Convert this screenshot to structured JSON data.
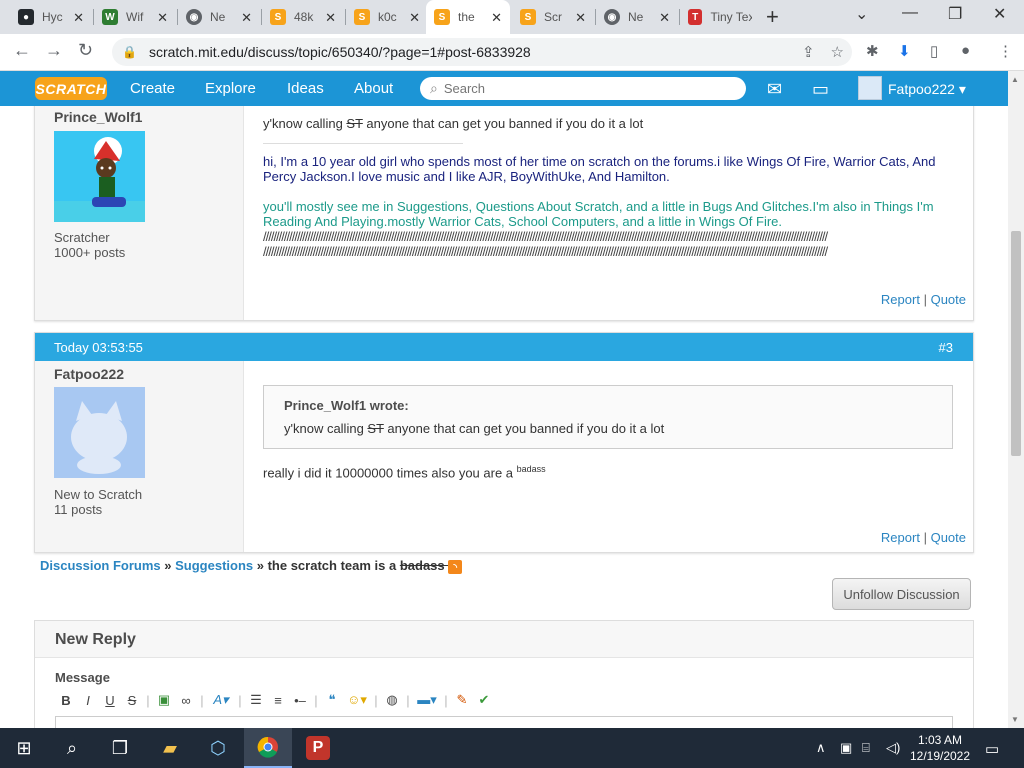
{
  "browser": {
    "tabs": [
      {
        "title": "Hyc",
        "fav": "github-icon",
        "color": "#24292e"
      },
      {
        "title": "Wif",
        "fav": "wifi-tool-icon",
        "color": "#2e7d32"
      },
      {
        "title": "Ne",
        "fav": "chrome-icon",
        "color": "#5f6368"
      },
      {
        "title": "48k",
        "fav": "scratch-icon",
        "color": "#f7a31a"
      },
      {
        "title": "k0c",
        "fav": "scratch-icon",
        "color": "#f7a31a"
      },
      {
        "title": "the",
        "fav": "scratch-icon",
        "color": "#f7a31a"
      },
      {
        "title": "Scr",
        "fav": "scratch-icon",
        "color": "#f7a31a"
      },
      {
        "title": "Ne",
        "fav": "chrome-icon",
        "color": "#5f6368"
      },
      {
        "title": "Tiny Tex",
        "fav": "tinytex-icon",
        "color": "#d32f2f"
      }
    ],
    "url": "scratch.mit.edu/discuss/topic/650340/?page=1#post-6833928"
  },
  "scratch": {
    "logo": "SCRATCH",
    "nav": [
      "Create",
      "Explore",
      "Ideas",
      "About"
    ],
    "search_placeholder": "Search",
    "username": "Fatpoo222 ▾"
  },
  "post1": {
    "author": "Prince_Wolf1",
    "rank": "Scratcher",
    "posts": "1000+ posts",
    "line1_a": "y'know calling ",
    "line1_st": "ST",
    "line1_b": " anyone that can get you banned if you do it a lot",
    "sig1": "hi, I'm a 10 year old girl who spends most of her time on scratch on the forums.i like Wings Of Fire, Warrior Cats, And Percy Jackson.I love music and I like AJR, BoyWithUke, And Hamilton.",
    "sig2": "you'll mostly see me in Suggestions, Questions About Scratch, and a little in Bugs And Glitches.I'm also in Things I'm Reading And Playing.mostly Warrior Cats, School Computers, and a little in Wings Of Fire.",
    "slashes1": "////////////////////////////////////////////////////////////////////////////////////////////////////////////////////////////////////////////////////////////////////////////////////////////////////////////////////////",
    "slashes2": "////////////////////////////////////////////////////////////////////////////////////////////////////////////////////////////////////////////////////////////////////////////////////////////////////////////////////////",
    "report": "Report",
    "quote": "Quote"
  },
  "post2": {
    "timestamp": "Today 03:53:55",
    "number": "#3",
    "author": "Fatpoo222",
    "rank": "New to Scratch",
    "posts": "11 posts",
    "quote_header": "Prince_Wolf1 wrote:",
    "quote_a": "y'know calling ",
    "quote_st": "ST",
    "quote_b": " anyone that can get you banned if you do it a lot",
    "reply": "really i did it 10000000 times also you are a ",
    "reply_sup": "badass",
    "report": "Report",
    "quote": "Quote"
  },
  "breadcrumb": {
    "forums": "Discussion Forums",
    "sep1": " » ",
    "category": "Suggestions",
    "sep2": " » ",
    "topic": "the scratch team is a ",
    "topic_strike": "badass "
  },
  "unfollow_label": "Unfollow Discussion",
  "new_reply": {
    "title": "New Reply",
    "message_label": "Message"
  },
  "taskbar": {
    "time": "1:03 AM",
    "date": "12/19/2022"
  }
}
